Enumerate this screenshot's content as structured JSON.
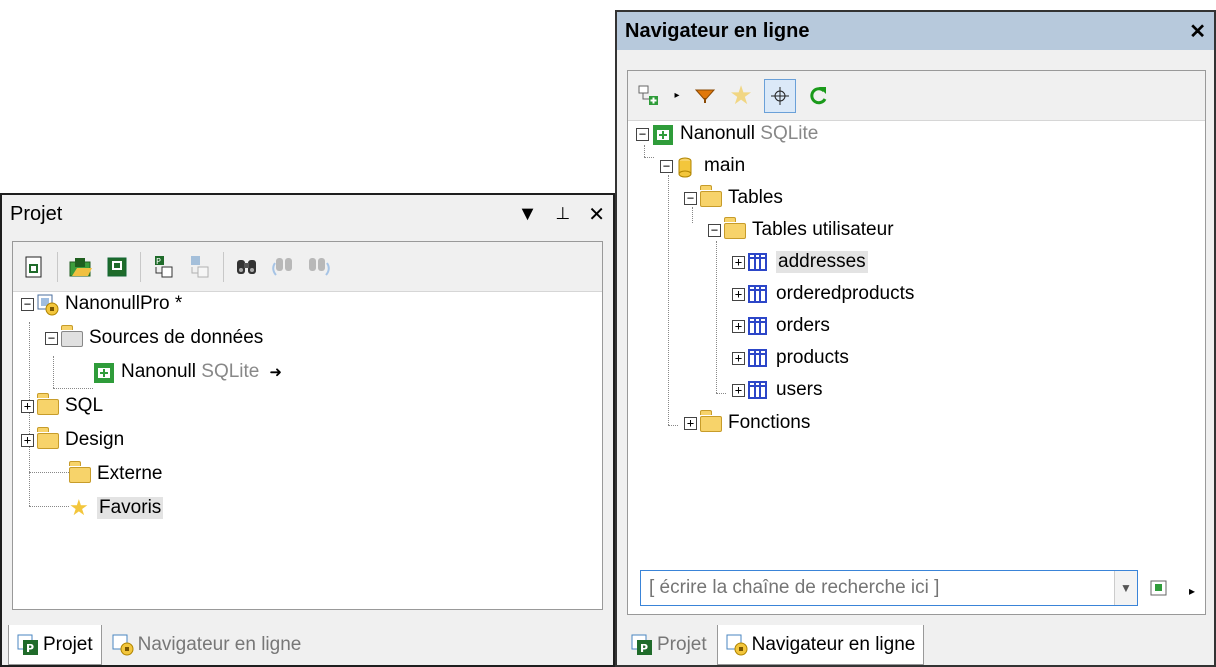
{
  "project_panel": {
    "title": "Projet",
    "pin_glyph": "▾",
    "autohide_glyph": "📌",
    "close_glyph": "✕",
    "toolbar_icons": [
      "new-project-icon",
      "open-project-icon",
      "save-project-icon",
      "add-file-icon",
      "remove-file-icon",
      "find-icon",
      "find-prev-icon",
      "find-next-icon"
    ],
    "tree": {
      "root": "NanonullPro *",
      "datasources": "Sources de données",
      "connection_name": "Nanonull",
      "connection_type": "SQLite",
      "connection_arrow": "➜",
      "sql": "SQL",
      "design": "Design",
      "externe": "Externe",
      "favoris": "Favoris"
    },
    "tabs": [
      {
        "label": "Projet"
      },
      {
        "label": "Navigateur en ligne"
      }
    ]
  },
  "navigator_panel": {
    "title": "Navigateur en ligne",
    "close_glyph": "✕",
    "toolbar_icons": [
      "add-object-icon",
      "dropdown-arrow-icon",
      "filter-icon",
      "favorites-star-icon",
      "locate-crosshair-icon",
      "refresh-icon"
    ],
    "tree": {
      "connection_name": "Nanonull",
      "connection_type": "SQLite",
      "schema": "main",
      "tables": "Tables",
      "user_tables": "Tables utilisateur",
      "table_items": [
        "addresses",
        "orderedproducts",
        "orders",
        "products",
        "users"
      ],
      "functions": "Fonctions"
    },
    "search": {
      "placeholder": "[ écrire la chaîne de recherche ici ]",
      "value": ""
    },
    "tabs": [
      {
        "label": "Projet"
      },
      {
        "label": "Navigateur en ligne"
      }
    ]
  },
  "colors": {
    "nav_title_bg": "#b7c9dc",
    "folder": "#f7d36a",
    "table_icon": "#2c46c8",
    "refresh": "#1a9a1a",
    "filter": "#e0780b",
    "star": "#f3c63c"
  }
}
